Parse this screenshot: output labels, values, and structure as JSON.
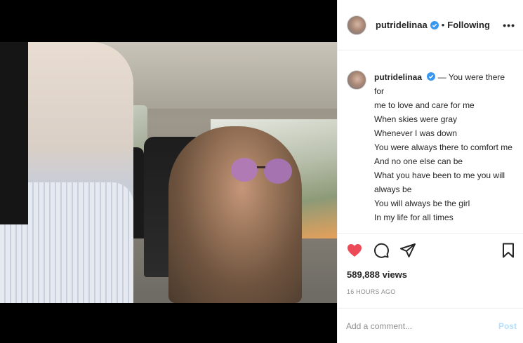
{
  "post": {
    "username": "putridelinaa",
    "verified": true,
    "separator": "•",
    "follow_status": "Following",
    "more_label": "•••"
  },
  "caption": {
    "username": "putridelinaa",
    "lines": [
      "— You were there for",
      "me to love and care for me",
      "When skies were gray",
      "Whenever I was down",
      "You were always there to comfort me",
      "And no one else can be",
      "What you have been to me you will",
      "always be",
      "You will always be the girl",
      "In my life for all times"
    ]
  },
  "actions": {
    "liked": true,
    "views": "589,888 views",
    "time_ago": "16 HOURS AGO"
  },
  "comment": {
    "placeholder": "Add a comment...",
    "post_label": "Post"
  },
  "colors": {
    "like_red": "#ed4956",
    "verified_blue": "#3897f0",
    "post_disabled": "#b2dffc"
  },
  "icons": {
    "like": "heart-icon",
    "comment": "comment-icon",
    "share": "share-icon",
    "save": "bookmark-icon",
    "more": "more-options-icon",
    "verified": "verified-badge-icon"
  }
}
